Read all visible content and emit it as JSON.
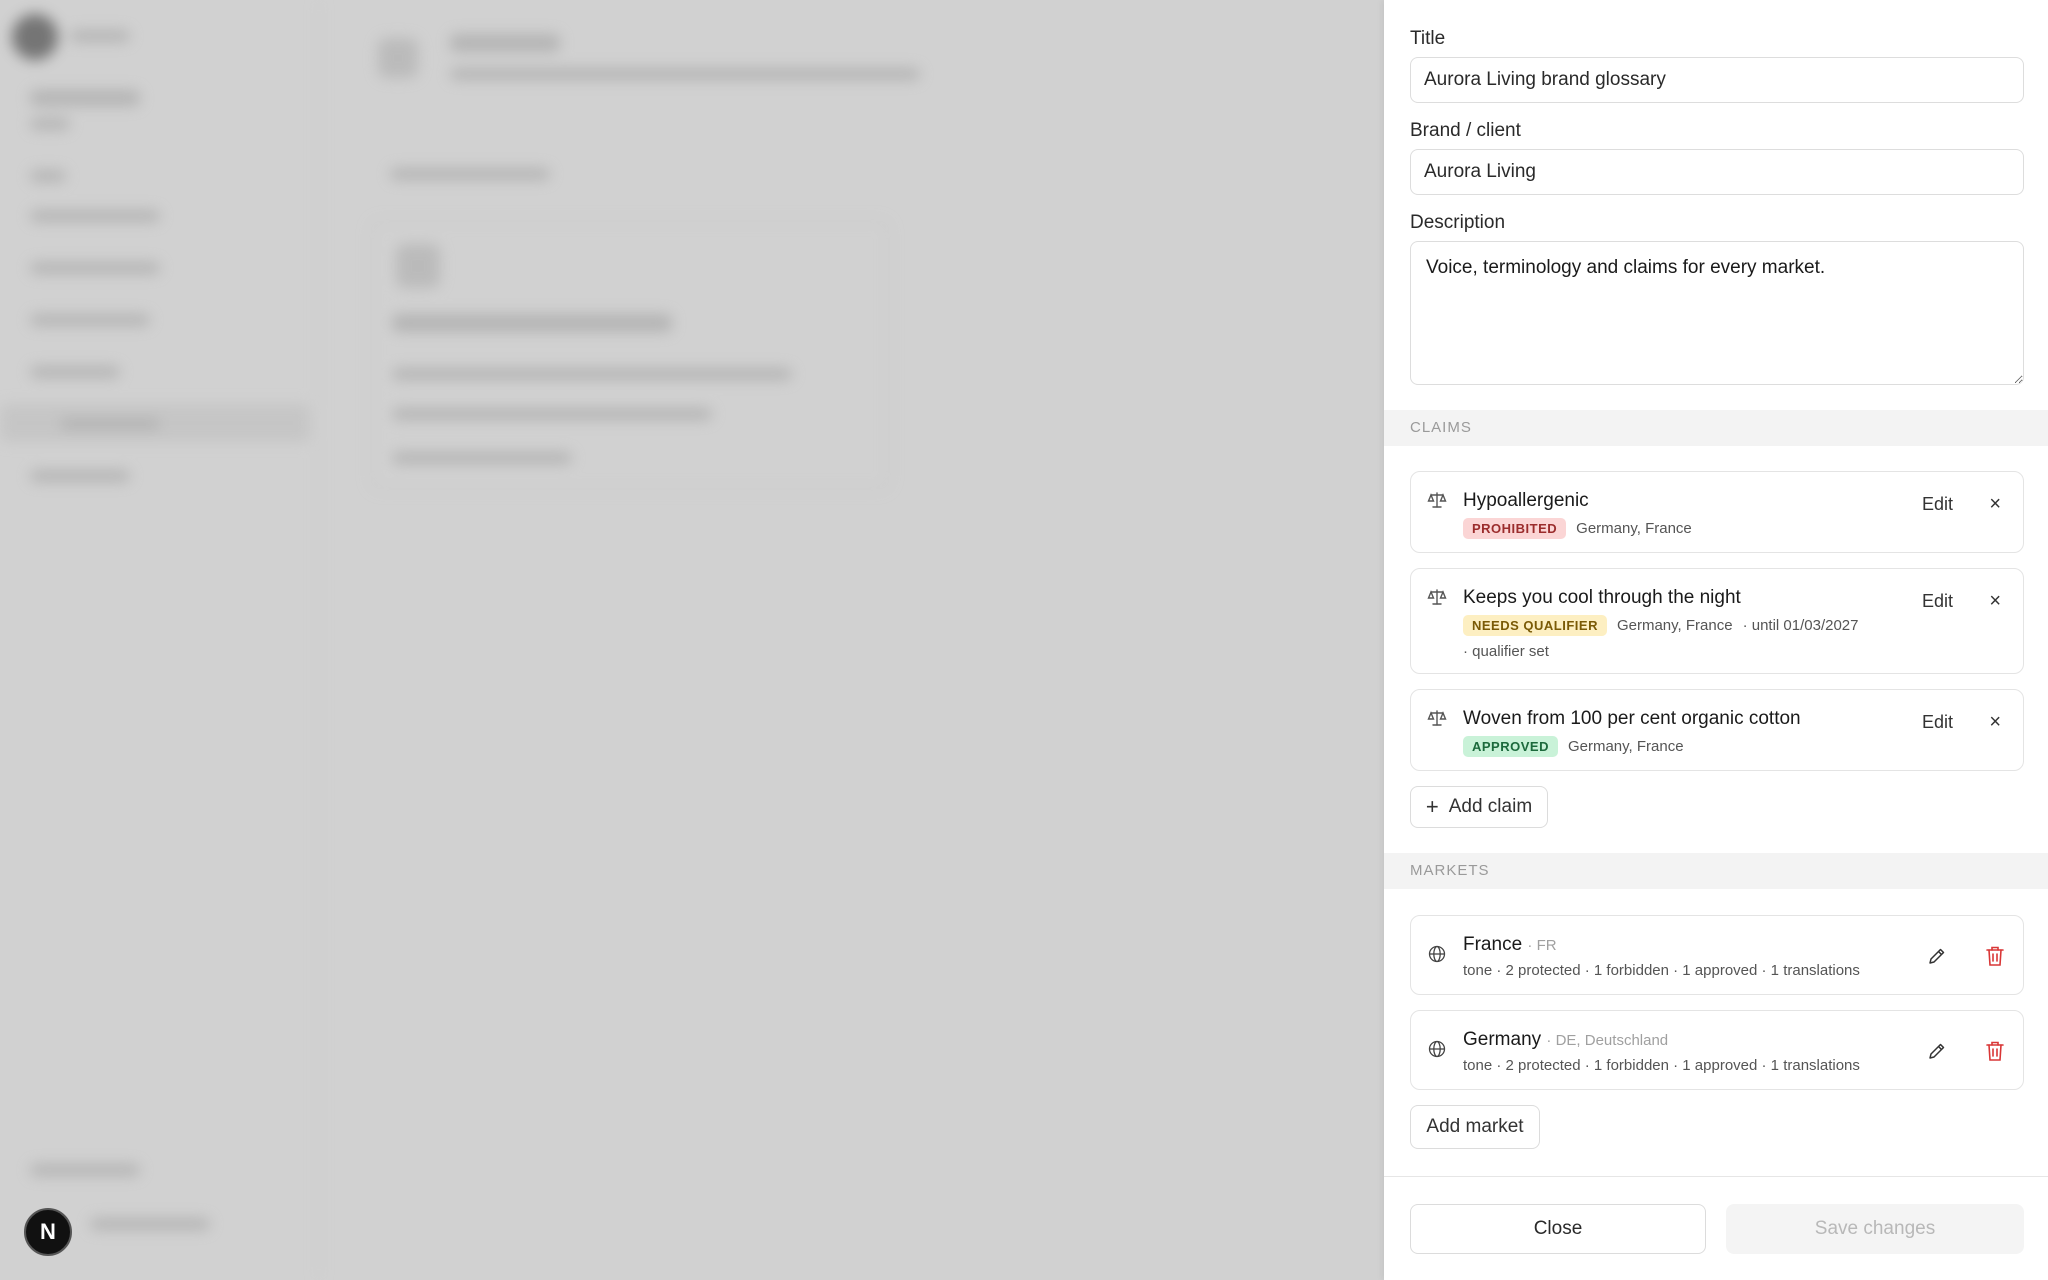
{
  "panel": {
    "title_label": "Title",
    "title_value": "Aurora Living brand glossary",
    "brand_label": "Brand / client",
    "brand_value": "Aurora Living",
    "description_label": "Description",
    "description_value": "Voice, terminology and claims for every market."
  },
  "claims": {
    "section_label": "CLAIMS",
    "items": [
      {
        "title": "Hypoallergenic",
        "status": "PROHIBITED",
        "markets": "Germany, France",
        "extra": "",
        "extra2": "",
        "edit_label": "Edit",
        "remove_label": "×"
      },
      {
        "title": "Keeps you cool through the night",
        "status": "NEEDS QUALIFIER",
        "markets": "Germany, France",
        "extra": "· until 01/03/2027",
        "extra2": "· qualifier set",
        "edit_label": "Edit",
        "remove_label": "×"
      },
      {
        "title": "Woven from 100 per cent organic cotton",
        "status": "APPROVED",
        "markets": "Germany, France",
        "extra": "",
        "extra2": "",
        "edit_label": "Edit",
        "remove_label": "×"
      }
    ],
    "add_label": "Add claim"
  },
  "markets": {
    "section_label": "MARKETS",
    "items": [
      {
        "name": "France",
        "code": "· FR",
        "stats": "tone · 2 protected · 1 forbidden · 1 approved · 1 translations"
      },
      {
        "name": "Germany",
        "code": "· DE, Deutschland",
        "stats": "tone · 2 protected · 1 forbidden · 1 approved · 1 translations"
      }
    ],
    "add_label": "Add market"
  },
  "footer": {
    "close_label": "Close",
    "save_label": "Save changes"
  },
  "overlay": {
    "n_badge": "N"
  },
  "colors": {
    "prohibited_bg": "#fbd5d5",
    "qualifier_bg": "#fdefc2",
    "approved_bg": "#c9f2d8",
    "delete_red": "#d93636"
  }
}
